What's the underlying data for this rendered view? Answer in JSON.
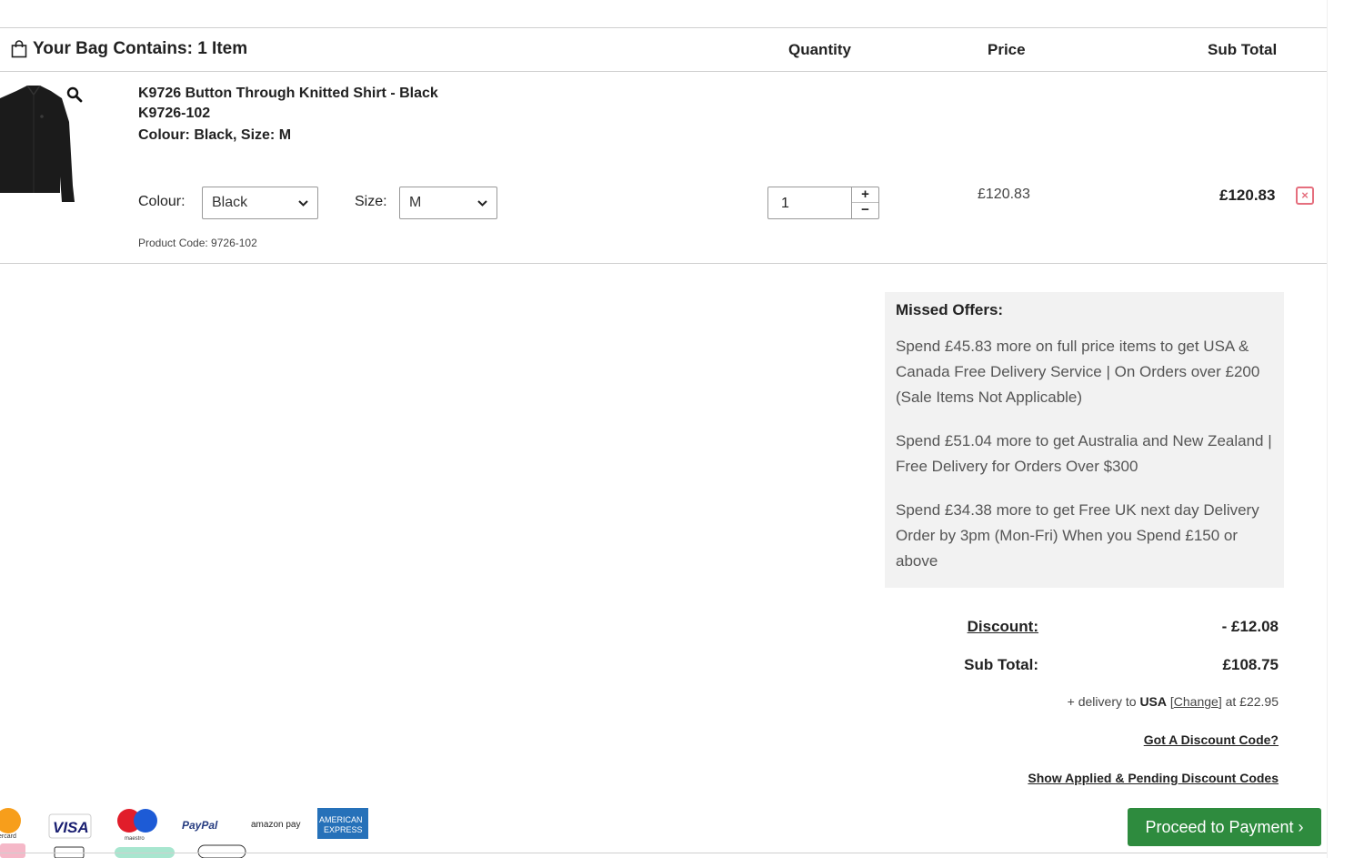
{
  "top": {
    "faded_text": "· · ·"
  },
  "bag": {
    "title": "Your Bag Contains: 1 Item",
    "columns": {
      "quantity": "Quantity",
      "price": "Price",
      "subtotal": "Sub Total"
    }
  },
  "item": {
    "name": "K9726 Button Through Knitted Shirt - Black",
    "sku": "K9726-102",
    "variant": "Colour: Black, Size: M",
    "colour_label": "Colour:",
    "colour_value": "Black",
    "size_label": "Size:",
    "size_value": "M",
    "product_code": "Product Code: 9726-102",
    "quantity": "1",
    "plus": "+",
    "minus": "−",
    "unit_price": "£120.83",
    "line_total": "£120.83",
    "remove": "×"
  },
  "offers": {
    "title": "Missed Offers:",
    "items": [
      "Spend £45.83 more on full price items to get USA & Canada Free Delivery Service | On Orders over £200 (Sale Items Not Applicable)",
      "Spend £51.04 more to get Australia and New Zealand | Free Delivery for Orders Over $300",
      "Spend £34.38 more to get Free UK next day Delivery Order by 3pm (Mon-Fri) When you Spend £150 or above"
    ]
  },
  "summary": {
    "discount_label": "Discount:",
    "discount_value": "- £12.08",
    "subtotal_label": "Sub Total:",
    "subtotal_value": "£108.75",
    "delivery_prefix": "+ delivery to",
    "delivery_country": "USA",
    "delivery_change": "Change",
    "delivery_suffix": "at £22.95",
    "discount_code_link": "Got A Discount Code?",
    "show_codes_link": "Show Applied & Pending Discount Codes"
  },
  "checkout": {
    "proceed": "Proceed to Payment ›"
  },
  "payment_logos": {
    "mastercard_text": "ercard",
    "visa": "VISA",
    "maestro": "maestro",
    "paypal": "PayPal",
    "amazonpay": "amazon pay",
    "amex_line1": "AMERICAN",
    "amex_line2": "EXPRESS"
  },
  "colors": {
    "accent_green": "#2e8b3e",
    "remove_red": "#e56f7e",
    "offers_bg": "#f2f2f2"
  }
}
